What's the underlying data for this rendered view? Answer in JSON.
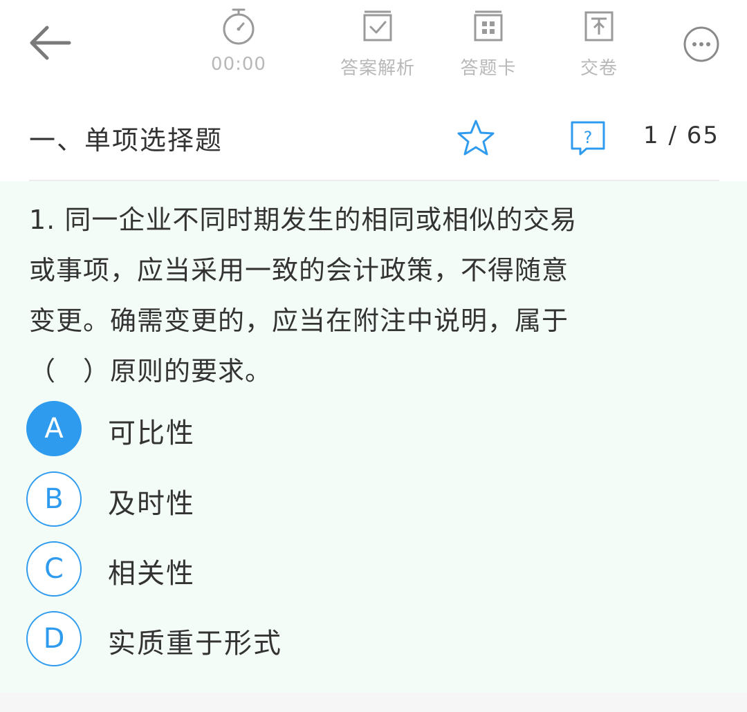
{
  "toolbar": {
    "back_icon": "arrow-left-icon",
    "timer": {
      "icon": "stopwatch-icon",
      "label": "00:00"
    },
    "analysis": {
      "icon": "analysis-icon",
      "label": "答案解析"
    },
    "answer_card": {
      "icon": "answer-card-icon",
      "label": "答题卡"
    },
    "submit": {
      "icon": "submit-paper-icon",
      "label": "交卷"
    },
    "more_icon": "more-icon"
  },
  "section": {
    "title": "一、单项选择题",
    "favorite_icon": "star-icon",
    "help_icon": "question-help-icon",
    "progress": "1 / 65"
  },
  "question": {
    "lines": [
      "1. 同一企业不同时期发生的相同或相似的交易",
      "或事项，应当采用一致的会计政策，不得随意",
      "变更。确需变更的，应当在附注中说明，属于",
      "（　）原则的要求。"
    ],
    "options": [
      {
        "letter": "A",
        "text": "可比性",
        "selected": true
      },
      {
        "letter": "B",
        "text": "及时性",
        "selected": false
      },
      {
        "letter": "C",
        "text": "相关性",
        "selected": false
      },
      {
        "letter": "D",
        "text": "实质重于形式",
        "selected": false
      }
    ]
  },
  "colors": {
    "accent": "#2f9bef",
    "icon_gray": "#9a9a9a",
    "label_gray": "#b8b8b8",
    "question_bg": "#f4fcf7",
    "text": "#333333"
  }
}
